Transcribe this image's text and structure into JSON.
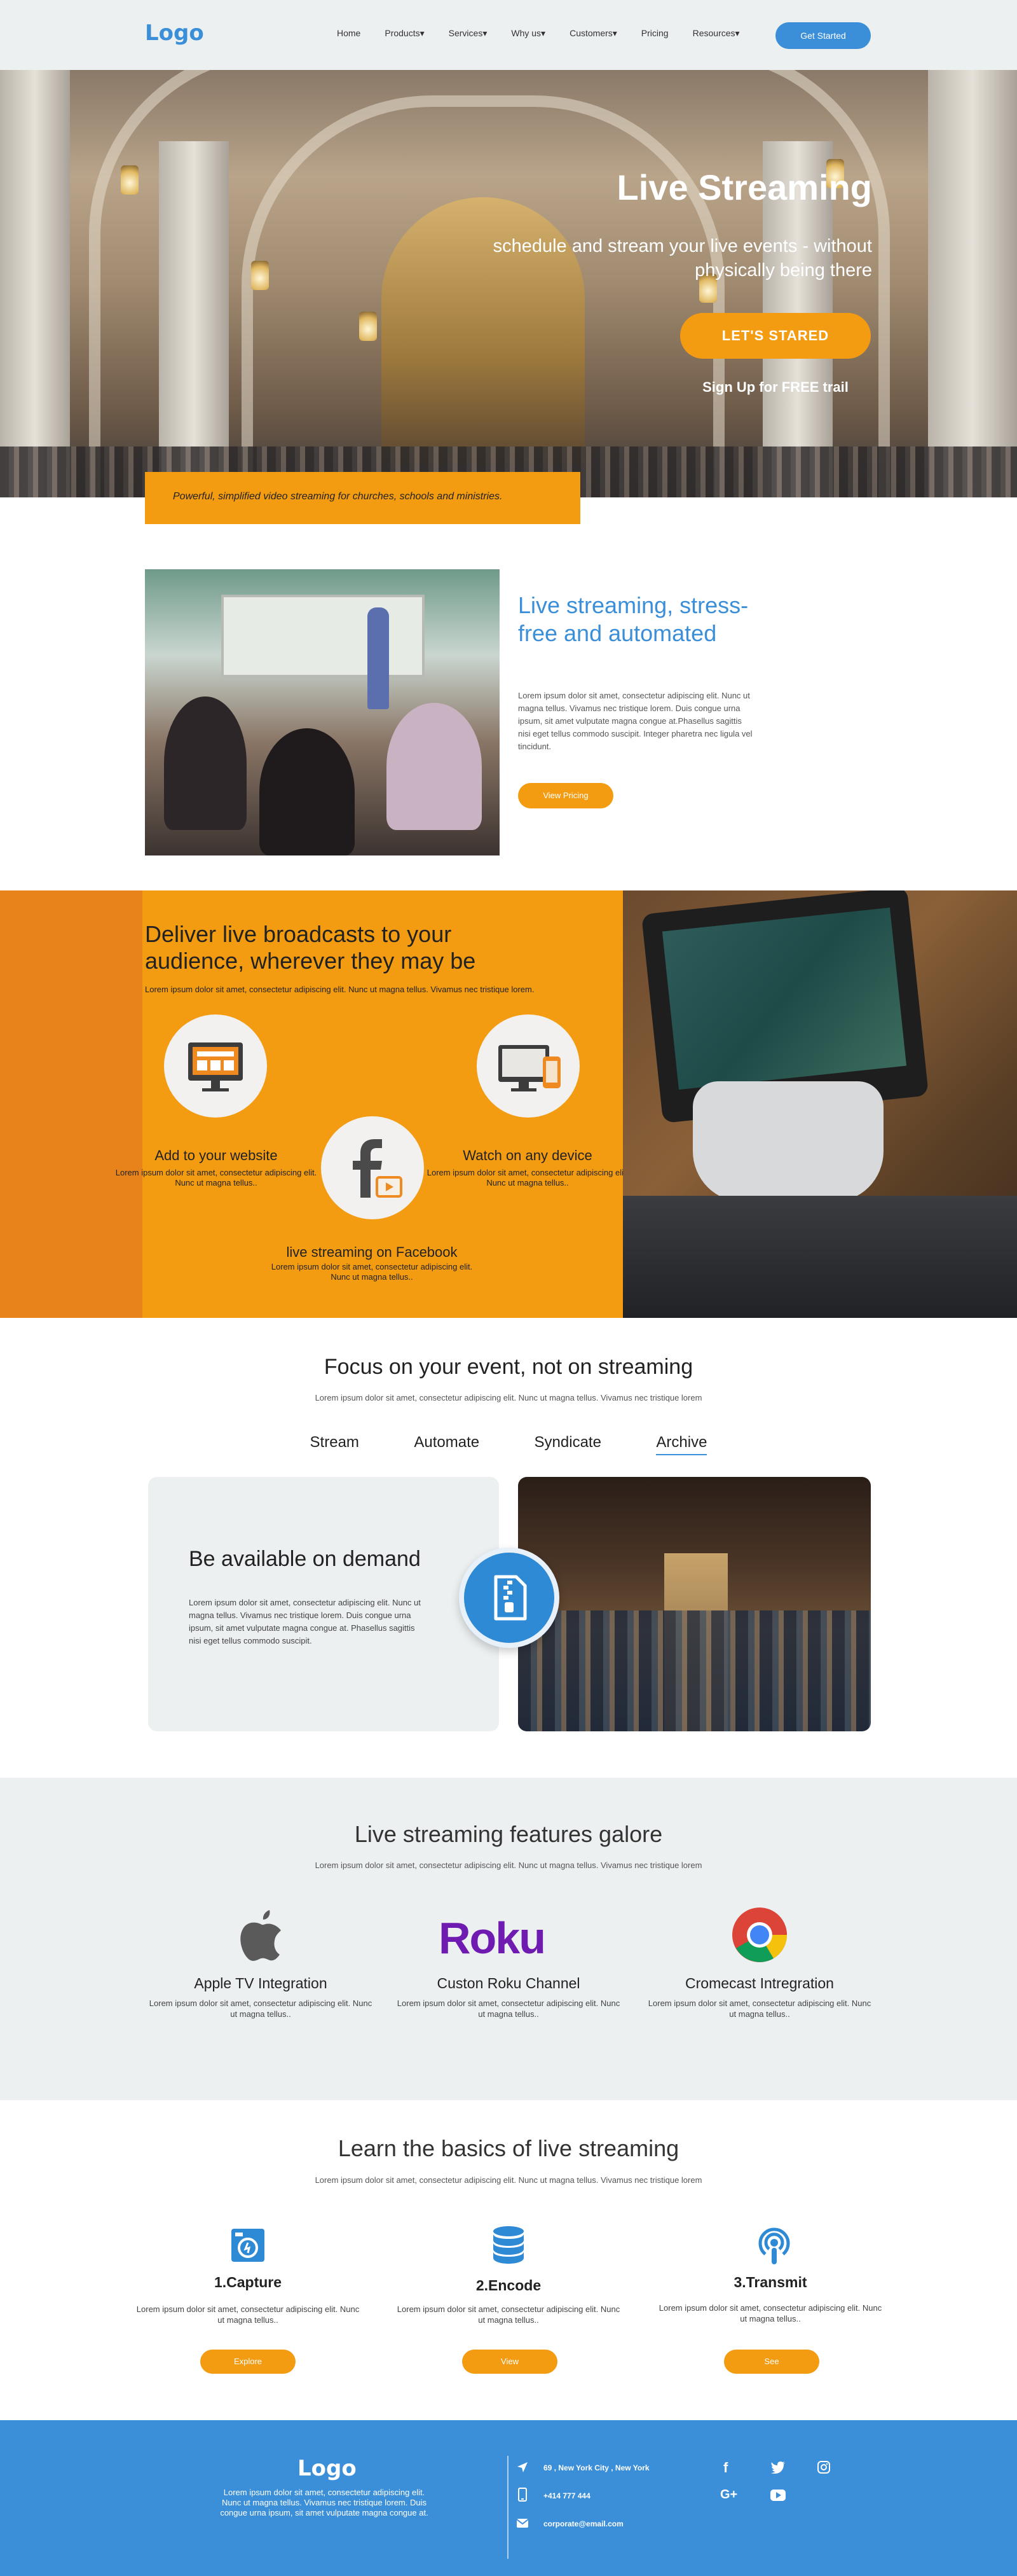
{
  "header": {
    "logo": "Logo",
    "nav": [
      "Home",
      "Products",
      "Services",
      "Why us",
      "Customers",
      "Pricing",
      "Resources"
    ],
    "cta": "Get Started"
  },
  "hero": {
    "title": "Live Streaming",
    "subtitle": "schedule and stream your live events - without physically being there",
    "cta": "LET'S STARED",
    "secondary": "Sign Up for FREE trail",
    "tagline": "Powerful, simplified video streaming for churches, schools and ministries."
  },
  "intro": {
    "title": "Live streaming, stress-free and automated",
    "text": "Lorem ipsum dolor sit amet, consectetur adipiscing elit. Nunc ut magna tellus. Vivamus nec tristique lorem. Duis congue urna ipsum, sit amet vulputate magna congue at.Phasellus sagittis nisi eget tellus commodo suscipit. Integer pharetra nec ligula vel tincidunt.",
    "cta": "View Pricing"
  },
  "broadcast": {
    "title": "Deliver live broadcasts to your audience, wherever they may be",
    "subtitle": "Lorem ipsum dolor sit amet, consectetur adipiscing elit. Nunc ut magna tellus. Vivamus nec tristique lorem.",
    "features": [
      {
        "title": "Add to your website",
        "text": "Lorem ipsum dolor sit amet, consectetur adipiscing elit. Nunc ut magna tellus.."
      },
      {
        "title": "Watch on any device",
        "text": "Lorem ipsum dolor sit amet, consectetur adipiscing elit. Nunc ut magna tellus.."
      },
      {
        "title": "live streaming on Facebook",
        "text": "Lorem ipsum dolor sit amet, consectetur adipiscing elit. Nunc ut magna tellus.."
      }
    ]
  },
  "focus": {
    "title": "Focus on your event, not on streaming",
    "subtitle": "Lorem ipsum dolor sit amet, consectetur adipiscing elit. Nunc ut magna tellus. Vivamus nec tristique lorem",
    "tabs": [
      "Stream",
      "Automate",
      "Syndicate",
      "Archive"
    ],
    "active_tab": "Archive",
    "card_title": "Be available on demand",
    "card_text": "Lorem ipsum dolor sit amet, consectetur adipiscing elit. Nunc ut magna tellus. Vivamus nec tristique lorem. Duis congue urna ipsum, sit amet vulputate magna congue at. Phasellus sagittis nisi eget tellus commodo suscipit."
  },
  "features": {
    "title": "Live streaming features galore",
    "subtitle": "Lorem ipsum dolor sit amet, consectetur adipiscing elit. Nunc ut magna tellus. Vivamus nec tristique lorem",
    "roku_wordmark": "Roku",
    "items": [
      {
        "title": "Apple TV Integration",
        "text": "Lorem ipsum dolor sit amet, consectetur adipiscing elit. Nunc ut magna tellus.."
      },
      {
        "title": "Custon Roku Channel",
        "text": "Lorem ipsum dolor sit amet, consectetur adipiscing elit. Nunc ut magna tellus.."
      },
      {
        "title": "Cromecast Intregration",
        "text": "Lorem ipsum dolor sit amet, consectetur adipiscing elit. Nunc ut magna tellus.."
      }
    ]
  },
  "basics": {
    "title": "Learn the basics of live streaming",
    "subtitle": "Lorem ipsum dolor sit amet, consectetur adipiscing elit. Nunc ut magna tellus. Vivamus nec tristique lorem",
    "steps": [
      {
        "title": "1.Capture",
        "text": "Lorem ipsum dolor sit amet, consectetur adipiscing elit. Nunc ut magna tellus..",
        "cta": "Explore"
      },
      {
        "title": "2.Encode",
        "text": "Lorem ipsum dolor sit amet, consectetur adipiscing elit. Nunc ut magna tellus..",
        "cta": "View"
      },
      {
        "title": "3.Transmit",
        "text": "Lorem ipsum dolor sit amet, consectetur adipiscing elit. Nunc ut magna tellus..",
        "cta": "See"
      }
    ]
  },
  "footer": {
    "logo": "Logo",
    "text": "Lorem ipsum dolor sit amet, consectetur adipiscing elit. Nunc ut magna tellus. Vivamus nec tristique lorem. Duis congue urna ipsum, sit amet vulputate magna congue at.",
    "address": "69 , New York City , New York",
    "phone": "+414 777 444",
    "email": "corporate@email.com"
  },
  "colors": {
    "blue": "#3b8fd9",
    "orange": "#f39c12",
    "grey": "#ecf0f1",
    "roku": "#6f1ab1"
  }
}
